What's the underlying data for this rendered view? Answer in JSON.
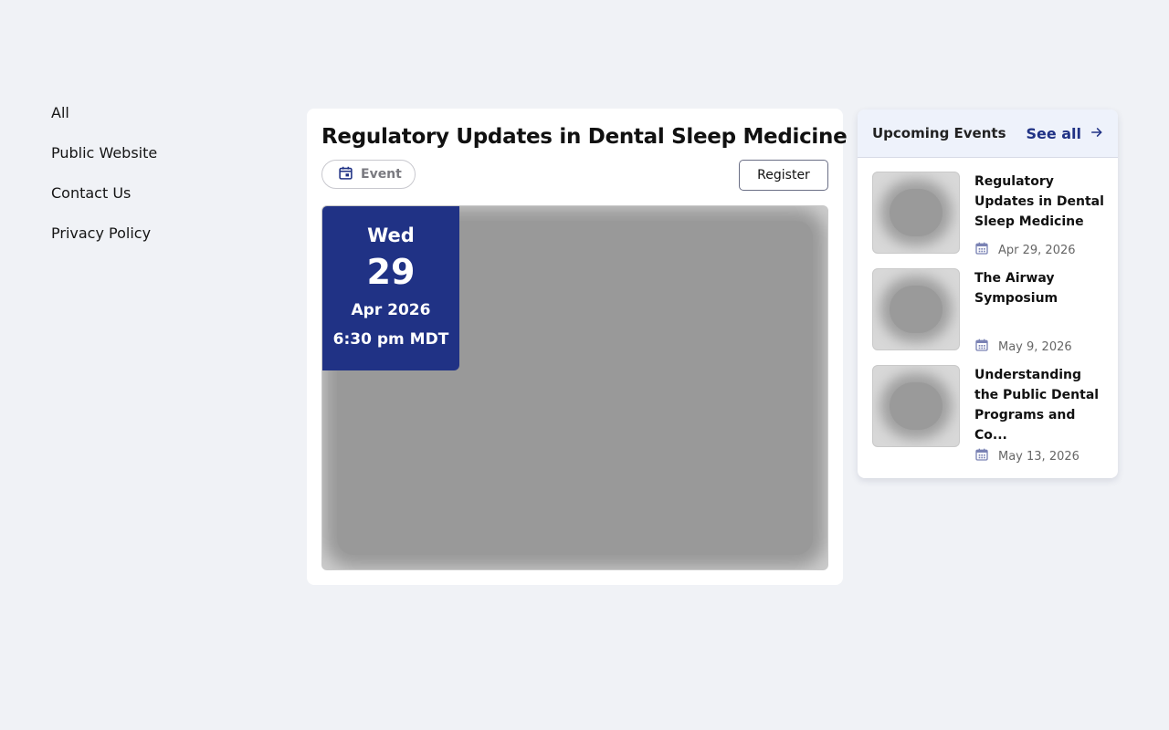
{
  "sidebar": {
    "links": [
      "All",
      "Public Website",
      "Contact Us",
      "Privacy Policy"
    ]
  },
  "event": {
    "title": "Regulatory Updates in Dental Sleep Medicine",
    "type_label": "Event",
    "register_label": "Register",
    "date": {
      "weekday": "Wed",
      "day": "29",
      "month_year": "Apr 2026",
      "time": "6:30 pm MDT"
    }
  },
  "upcoming": {
    "title": "Upcoming Events",
    "see_all_label": "See all",
    "items": [
      {
        "name": "Regulatory Updates in Dental Sleep Medicine",
        "date": "Apr 29, 2026"
      },
      {
        "name": "The Airway Symposium",
        "date": "May 9, 2026"
      },
      {
        "name": "Understanding the Public Dental Programs and Co...",
        "date": "May 13, 2026"
      }
    ]
  },
  "icons": {
    "calendar": "calendar-icon",
    "arrow": "arrow-right-icon"
  },
  "colors": {
    "background": "#f0f2f6",
    "brand": "#203285",
    "card": "#ffffff"
  }
}
